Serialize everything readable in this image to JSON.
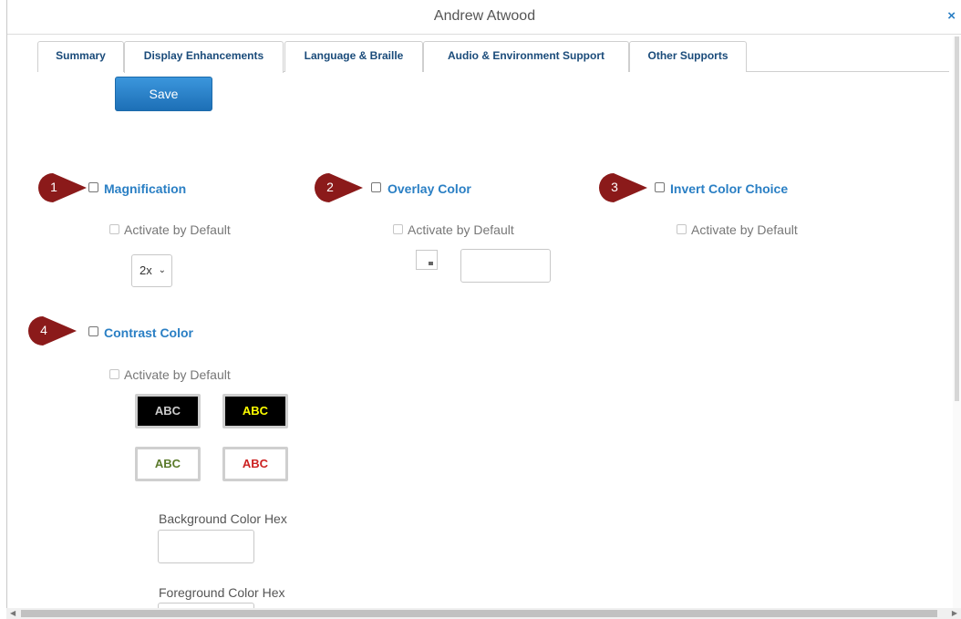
{
  "window": {
    "title": "Andrew Atwood",
    "close_label": "×"
  },
  "tabs": [
    {
      "label": "Summary"
    },
    {
      "label": "Display Enhancements",
      "active": true
    },
    {
      "label": "Language & Braille"
    },
    {
      "label": "Audio & Environment Support"
    },
    {
      "label": "Other Supports"
    }
  ],
  "toolbar": {
    "save_label": "Save"
  },
  "badges": [
    "1",
    "2",
    "3",
    "4"
  ],
  "badge_color": "#8b1a1a",
  "accent_color": "#2a7fc4",
  "sections": {
    "magnification": {
      "label": "Magnification",
      "activate_label": "Activate by Default",
      "zoom_value": "2x"
    },
    "overlay": {
      "label": "Overlay Color",
      "activate_label": "Activate by Default"
    },
    "invert": {
      "label": "Invert Color Choice",
      "activate_label": "Activate by Default"
    },
    "contrast": {
      "label": "Contrast Color",
      "activate_label": "Activate by Default",
      "swatches": [
        {
          "text": "ABC",
          "bg": "#000000",
          "fg": "#cccccc"
        },
        {
          "text": "ABC",
          "bg": "#000000",
          "fg": "#ffff00"
        },
        {
          "text": "ABC",
          "bg": "#ffffff",
          "fg": "#5a7a2a"
        },
        {
          "text": "ABC",
          "bg": "#ffffff",
          "fg": "#cc2222"
        }
      ],
      "background_hex_label": "Background Color Hex",
      "foreground_hex_label": "Foreground Color Hex"
    }
  }
}
